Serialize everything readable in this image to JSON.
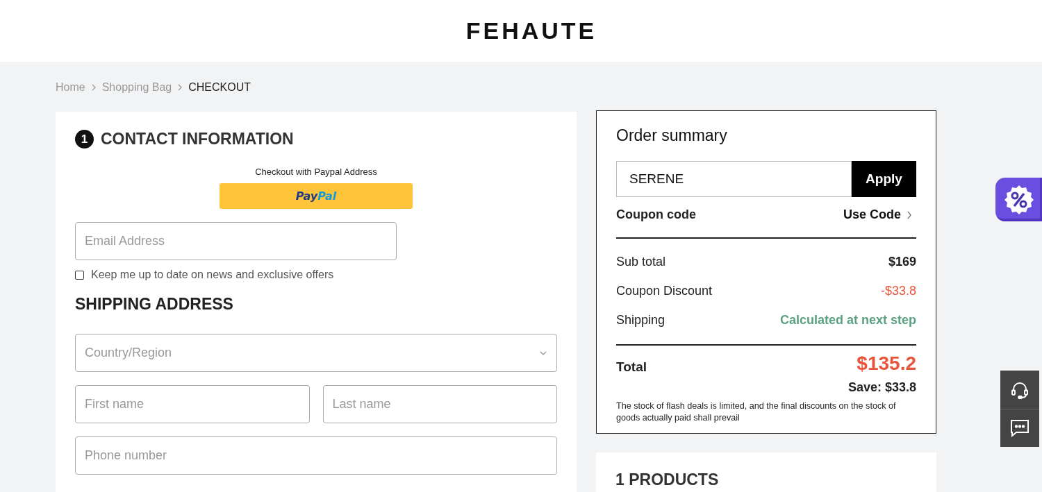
{
  "header": {
    "logo": "FEHAUTE"
  },
  "breadcrumb": [
    {
      "label": "Home",
      "selected": false
    },
    {
      "label": "Shopping Bag",
      "selected": false
    },
    {
      "label": "CHECKOUT",
      "selected": true
    }
  ],
  "contact": {
    "step": "1",
    "title": "CONTACT INFORMATION",
    "paypal_caption": "Checkout with Paypal Address",
    "paypal_logo": [
      "Pay",
      "Pal"
    ],
    "email": {
      "placeholder": "Email Address"
    },
    "newsletter": {
      "label": "Keep me up to date on news and exclusive offers",
      "checked": false
    }
  },
  "shipping": {
    "title": "SHIPPING ADDRESS",
    "country": {
      "placeholder": "Country/Region"
    },
    "first_name": {
      "placeholder": "First name"
    },
    "last_name": {
      "placeholder": "Last name"
    },
    "phone": {
      "placeholder": "Phone number"
    }
  },
  "summary": {
    "title": "Order summary",
    "coupon_input": {
      "value": "SERENE"
    },
    "apply": "Apply",
    "coupon_label": "Coupon code",
    "use_code": "Use Code",
    "lines": [
      {
        "label": "Sub total",
        "value": "$169",
        "kind": "plain"
      },
      {
        "label": "Coupon Discount",
        "value": "-$33.8",
        "kind": "discount"
      },
      {
        "label": "Shipping",
        "value": "Calculated at next step",
        "kind": "note"
      }
    ],
    "total_label": "Total",
    "total": "$135.2",
    "save": "Save: $33.8",
    "disclaimer": "The stock of flash deals is limited, and the final discounts on the stock of goods actually paid shall prevail"
  },
  "products": {
    "title": "1 PRODUCTS"
  }
}
